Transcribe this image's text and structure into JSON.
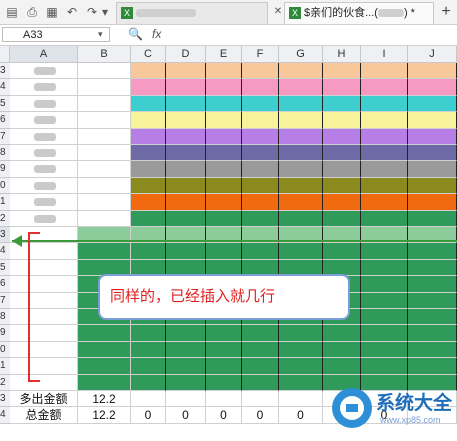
{
  "toolbar": {
    "tabs": [
      {
        "label": "",
        "active": false
      },
      {
        "label": "$亲们的伙食...(",
        "suffix": ") *",
        "active": true
      }
    ],
    "add_tab": "+",
    "close": "✕"
  },
  "formula_bar": {
    "cell_ref": "A33",
    "fx": "fx"
  },
  "columns": [
    "A",
    "B",
    "C",
    "D",
    "E",
    "F",
    "G",
    "H",
    "I",
    "J"
  ],
  "rows": [
    "3",
    "4",
    "5",
    "6",
    "7",
    "8",
    "9",
    "0",
    "1",
    "2",
    "3",
    "4",
    "5",
    "6",
    "7",
    "8",
    "9",
    "0",
    "1",
    "2",
    "3",
    "4"
  ],
  "colors": {
    "orange_light": "#f9c89a",
    "pink": "#f79ac3",
    "teal": "#3dcfcf",
    "yellow": "#f7f39b",
    "purple": "#b77fe6",
    "indigo": "#6e6aa6",
    "olive": "#8a8a1e",
    "orange": "#f26a10",
    "green": "#2f9a5a",
    "green_light": "#8ccc9a",
    "row_select": "#8ccc9a"
  },
  "summary": {
    "label_1": "多出金额",
    "label_2": "总金额",
    "val_b1": "12.2",
    "val_b2": "12.2",
    "zeros": [
      "0",
      "0",
      "0",
      "0",
      "0",
      "0",
      "0"
    ]
  },
  "callout": "同样的，已经插入就几行",
  "watermark": {
    "title": "系统大全",
    "url": "www.xp85.com"
  }
}
